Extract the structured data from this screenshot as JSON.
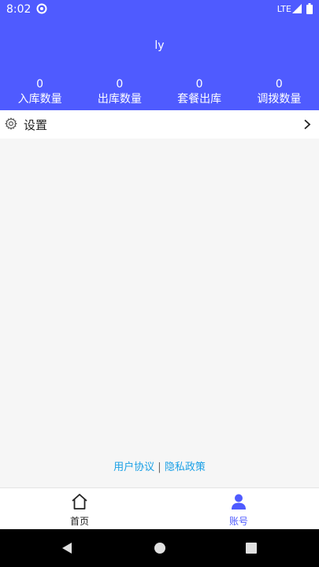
{
  "status_bar": {
    "time": "8:02",
    "network": "LTE"
  },
  "profile": {
    "username": "ly"
  },
  "stats": [
    {
      "value": "0",
      "label": "入库数量"
    },
    {
      "value": "0",
      "label": "出库数量"
    },
    {
      "value": "0",
      "label": "套餐出库"
    },
    {
      "value": "0",
      "label": "调拨数量"
    }
  ],
  "settings": {
    "label": "设置"
  },
  "footer_links": {
    "user_agreement": "用户协议",
    "separator": "|",
    "privacy_policy": "隐私政策"
  },
  "tabbar": [
    {
      "label": "首页",
      "icon": "home-icon",
      "active": false
    },
    {
      "label": "账号",
      "icon": "user-icon",
      "active": true
    }
  ],
  "colors": {
    "primary": "#4f5bff",
    "link": "#1aa0e6",
    "background": "#f6f6f6"
  }
}
